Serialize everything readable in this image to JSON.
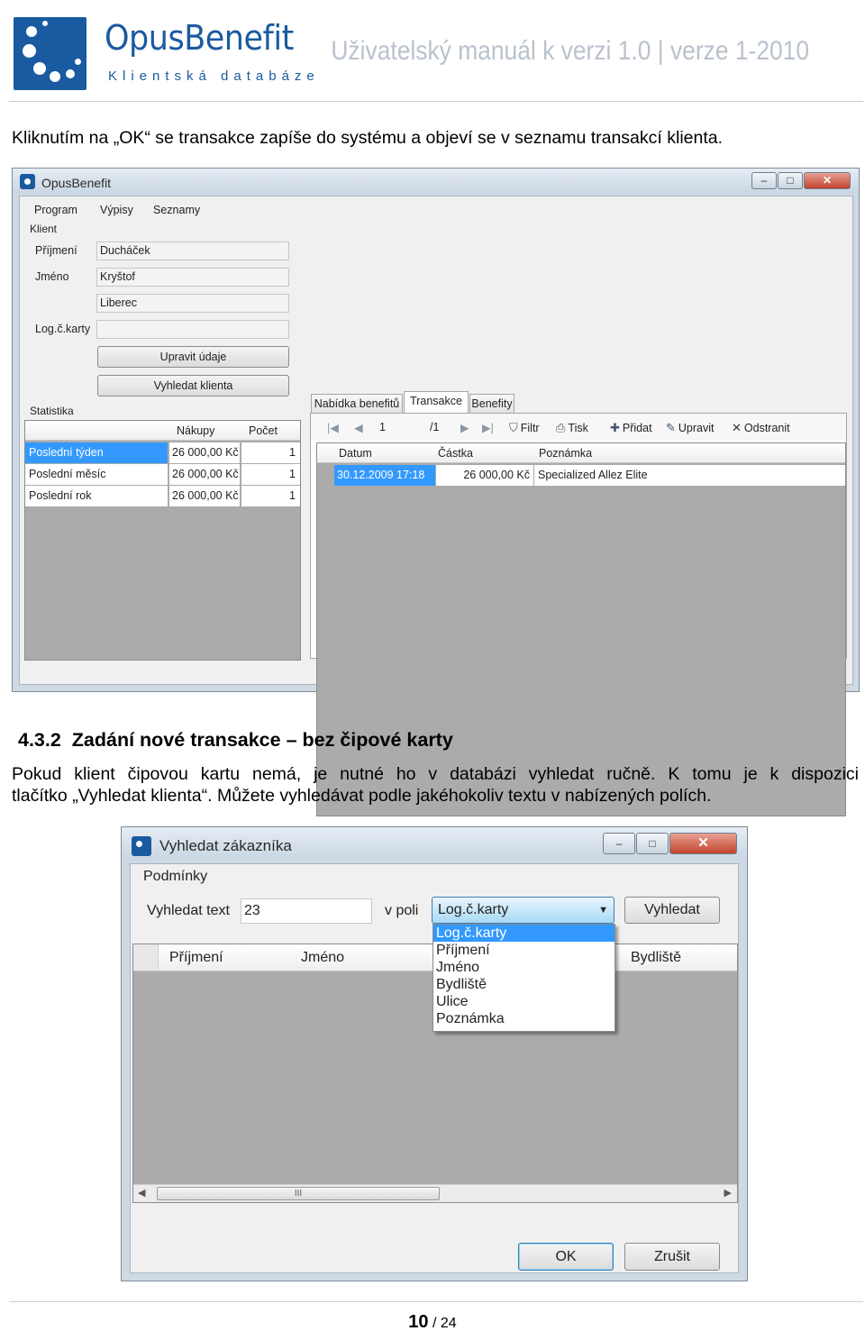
{
  "header": {
    "brand": "OpusBenefit",
    "brand_sub": "Klientská databáze",
    "doc_title": "Uživatelský manuál k verzi 1.0 | verze 1-2010",
    "colors": {
      "brand": "#1a5aa0",
      "title_grey": "#b9c2cc"
    }
  },
  "intro_text": "Kliknutím na „OK“ se transakce zapíše do systému a objeví se v seznamu transakcí klienta.",
  "app1": {
    "title": "OpusBenefit",
    "window_buttons": [
      "–",
      "□",
      "✕"
    ],
    "menu": [
      "Program",
      "Výpisy",
      "Seznamy"
    ],
    "client_group": "Klient",
    "fields": [
      {
        "label": "Příjmení",
        "value": "Ducháček"
      },
      {
        "label": "Jméno",
        "value": "Kryštof"
      },
      {
        "label": "",
        "value": "Liberec"
      },
      {
        "label": "Log.č.karty",
        "value": ""
      }
    ],
    "btn_edit": "Upravit údaje",
    "btn_find": "Vyhledat klienta",
    "stats_group": "Statistika",
    "stats_headers": [
      "Nákupy",
      "Počet"
    ],
    "stats_rows": [
      {
        "name": "Poslední týden",
        "amount": "26 000,00 Kč",
        "count": "1"
      },
      {
        "name": "Poslední měsíc",
        "amount": "26 000,00 Kč",
        "count": "1"
      },
      {
        "name": "Poslední rok",
        "amount": "26 000,00 Kč",
        "count": "1"
      }
    ],
    "tabs": [
      "Nabídka benefitů",
      "Transakce",
      "Benefity"
    ],
    "nav": {
      "first": "|◀",
      "prev": "◀",
      "current": "1",
      "total": "/1",
      "next": "▶",
      "last": "▶|"
    },
    "toolbar": [
      {
        "icon": "filter-icon",
        "glyph": "⛉",
        "label": "Filtr"
      },
      {
        "icon": "print-icon",
        "glyph": "⎙",
        "label": "Tisk"
      },
      {
        "icon": "add-icon",
        "glyph": "✚",
        "label": "Přidat"
      },
      {
        "icon": "edit-icon",
        "glyph": "✎",
        "label": "Upravit"
      },
      {
        "icon": "delete-icon",
        "glyph": "✕",
        "label": "Odstranit"
      }
    ],
    "grid_headers": [
      "Datum",
      "Částka",
      "Poznámka"
    ],
    "grid_row": {
      "date": "30.12.2009 17:18",
      "amount": "26 000,00 Kč",
      "note": "Specialized Allez Elite"
    }
  },
  "section": {
    "number": "4.3.2",
    "title": "Zadání nové transakce – bez čipové karty",
    "para_line1": "Pokud klient čipovou kartu nemá, je nutné ho v databázi vyhledat ručně. K tomu je k dispozici",
    "para_line2": "tlačítko „Vyhledat klienta“. Můžete vyhledávat podle jakéhokoliv textu v nabízených polích."
  },
  "dialog": {
    "title": "Vyhledat zákazníka",
    "window_buttons": [
      "–",
      "□",
      "✕"
    ],
    "group": "Podmínky",
    "search_label": "Vyhledat text",
    "search_value": "23",
    "field_label": "v poli",
    "field_selected": "Log.č.karty",
    "field_options": [
      "Log.č.karty",
      "Příjmení",
      "Jméno",
      "Bydliště",
      "Ulice",
      "Poznámka"
    ],
    "btn_search": "Vyhledat",
    "columns": [
      "Příjmení",
      "Jméno",
      "Bydliště"
    ],
    "scroll_grip": "III",
    "btn_ok": "OK",
    "btn_cancel": "Zrušit"
  },
  "footer": {
    "page": "10",
    "total": "24"
  }
}
